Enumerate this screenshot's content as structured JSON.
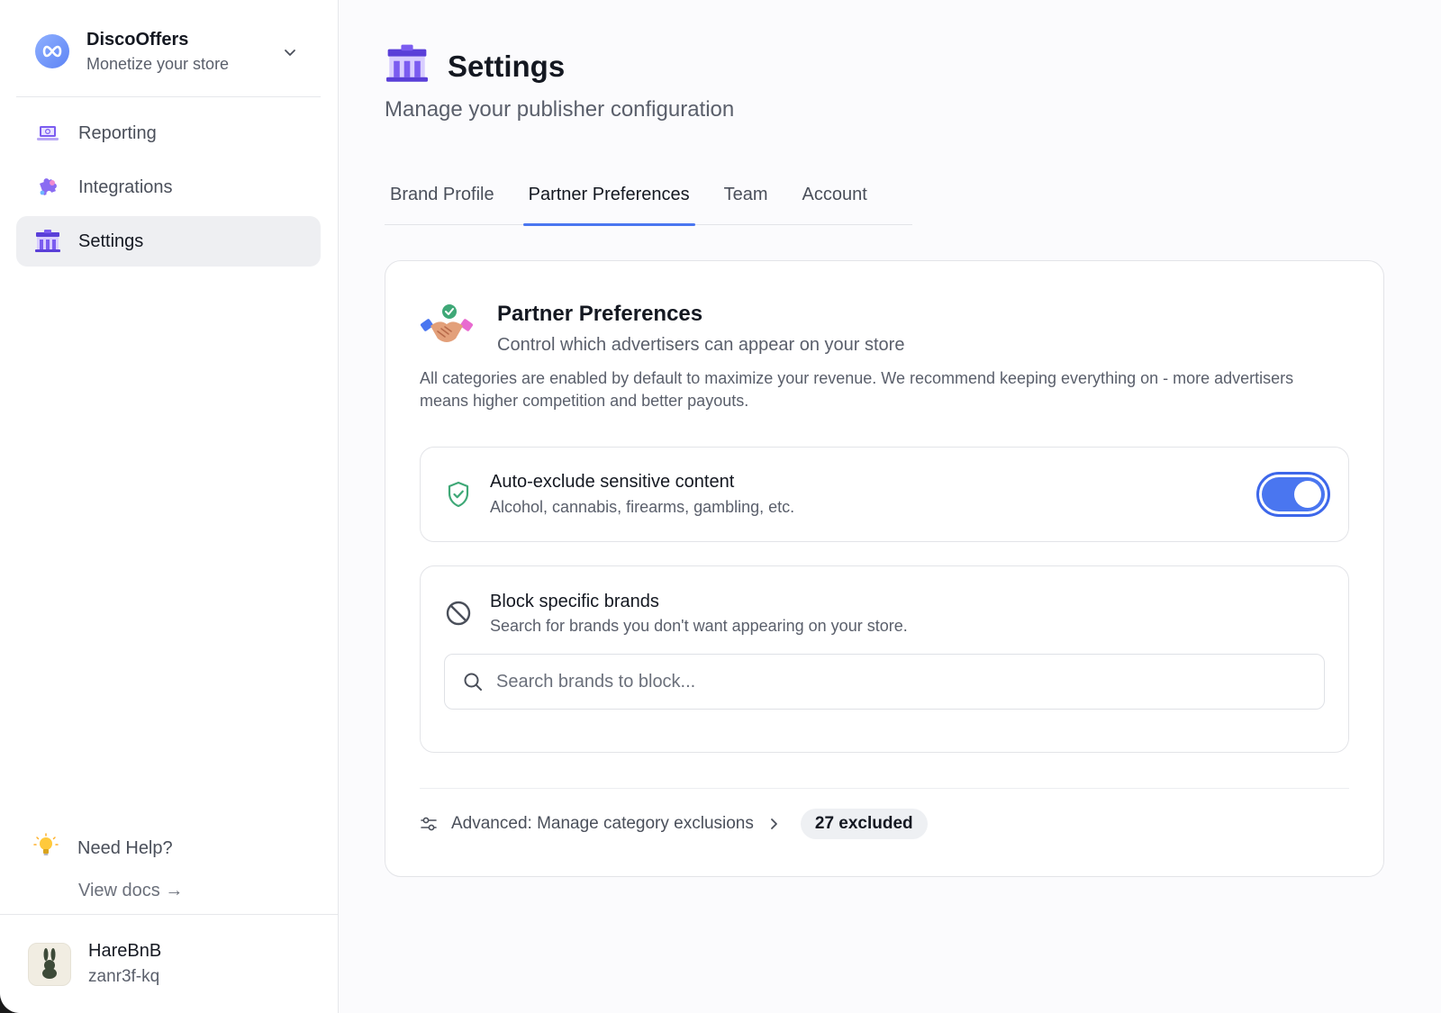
{
  "brand": {
    "name": "DiscoOffers",
    "tagline": "Monetize your store",
    "logo_icon": "infinity-logo-icon",
    "accent": "#5d84f5"
  },
  "sidebar": {
    "items": [
      {
        "label": "Reporting",
        "icon": "laptop-icon",
        "active": false
      },
      {
        "label": "Integrations",
        "icon": "puzzle-icon",
        "active": false
      },
      {
        "label": "Settings",
        "icon": "storefront-icon",
        "active": true
      }
    ],
    "help": {
      "label": "Need Help?",
      "link": "View docs →",
      "icon": "lightbulb-icon"
    },
    "user": {
      "name": "HareBnB",
      "id": "zanr3f-kq",
      "avatar_icon": "rabbit-avatar-icon"
    }
  },
  "page": {
    "title": "Settings",
    "subtitle": "Manage your publisher configuration",
    "tabs": [
      {
        "label": "Brand Profile",
        "active": false
      },
      {
        "label": "Partner Preferences",
        "active": true
      },
      {
        "label": "Team",
        "active": false
      },
      {
        "label": "Account",
        "active": false
      }
    ]
  },
  "card": {
    "title": "Partner Preferences",
    "subtitle": "Control which advertisers can appear on your store",
    "description": "All categories are enabled by default to maximize your revenue. We recommend keeping everything on - more advertisers means higher competition and better payouts.",
    "auto_exclude": {
      "title": "Auto-exclude sensitive content",
      "subtitle": "Alcohol, cannabis, firearms, gambling, etc.",
      "enabled": true,
      "icon": "shield-check-icon"
    },
    "block_brands": {
      "title": "Block specific brands",
      "subtitle": "Search for brands you don't want appearing on your store.",
      "search_placeholder": "Search brands to block...",
      "search_value": "",
      "icon": "block-icon"
    },
    "advanced": {
      "label": "Advanced: Manage category exclusions",
      "badge": "27 excluded",
      "icon": "sliders-icon"
    }
  },
  "colors": {
    "accent": "#4a76f0",
    "toggle_border": "#3d67ea",
    "shield_green": "#3fa877"
  }
}
